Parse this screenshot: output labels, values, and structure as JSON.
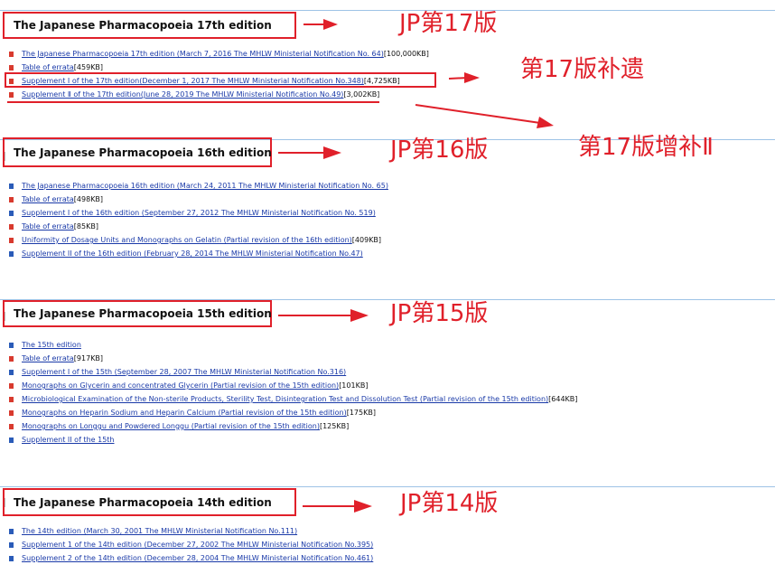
{
  "sections": [
    {
      "title": "The Japanese Pharmacopoeia 17th edition",
      "annotation": "JP第17版",
      "items": [
        {
          "text": "The Japanese Pharmacopoeia 17th edition (March 7, 2016 The MHLW Ministerial  Notification No. 64)",
          "size": "[100,000KB]",
          "type": "pdf"
        },
        {
          "text": "Table of errata",
          "size": "[459KB]",
          "type": "pdf"
        },
        {
          "text": "Supplement I of the 17th edition(December 1, 2017 The MHLW Ministerial Notification No.348)",
          "size": "[4,725KB]",
          "type": "pdf"
        },
        {
          "text": "Supplement  Ⅱ  of the 17th edition(June 28, 2019 The MHLW Ministerial Notification No.49)",
          "size": "[3,002KB]",
          "type": "pdf"
        }
      ]
    },
    {
      "title": "The Japanese Pharmacopoeia 16th edition",
      "annotation": "JP第16版",
      "items": [
        {
          "text": "The Japanese Pharmacopoeia 16th edition (March 24, 2011 The MHLW Ministerial  Notification No. 65)",
          "size": "",
          "type": "web"
        },
        {
          "text": "Table of errata",
          "size": "[498KB]",
          "type": "pdf"
        },
        {
          "text": "Supplement I of the 16th edition (September 27, 2012 The MHLW Ministerial Notification No. 519)",
          "size": "",
          "type": "web"
        },
        {
          "text": "Table of errata",
          "size": "[85KB]",
          "type": "pdf"
        },
        {
          "text": "Uniformity of Dosage Units and Monographs on Gelatin (Partial revision of the 16th edition)",
          "size": "[409KB]",
          "type": "pdf"
        },
        {
          "text": "Supplement II of the 16th edition (February 28, 2014 The MHLW Ministerial Notification No.47)",
          "size": "",
          "type": "web"
        }
      ]
    },
    {
      "title": "The Japanese Pharmacopoeia 15th edition",
      "annotation": "JP第15版",
      "items": [
        {
          "text": "The 15th edition",
          "size": "",
          "type": "web"
        },
        {
          "text": "Table of errata",
          "size": "[917KB]",
          "type": "pdf"
        },
        {
          "text": "Supplement I of the 15th (September 28, 2007 The MHLW Ministerial Notification No.316)",
          "size": "",
          "type": "web"
        },
        {
          "text": "Monographs on Glycerin and concentrated Glycerin (Partial revision of the 15th edition)",
          "size": "[101KB]",
          "type": "pdf"
        },
        {
          "text": "Microbiological Examination of the Non-sterile Products, Sterility Test, Disintegration Test and Dissolution Test (Partial revision of the 15th edition)",
          "size": "[644KB]",
          "type": "pdf"
        },
        {
          "text": "Monographs on Heparin Sodium and Heparin Calcium (Partial revision of the 15th edition)",
          "size": "[175KB]",
          "type": "pdf"
        },
        {
          "text": "Monographs on Longgu and Powdered Longgu (Partial revision of the 15th edition)",
          "size": "[125KB]",
          "type": "pdf"
        },
        {
          "text": "Supplement II of the 15th",
          "size": "",
          "type": "web"
        }
      ]
    },
    {
      "title": "The Japanese Pharmacopoeia 14th edition",
      "annotation": "JP第14版",
      "items": [
        {
          "text": "The 14th edition (March 30, 2001 The MHLW Ministerial Notification No.111)",
          "size": "",
          "type": "web"
        },
        {
          "text": "Supplement 1 of the 14th edition (December 27, 2002 The MHLW Ministerial Notification No.395)",
          "size": "",
          "type": "web"
        },
        {
          "text": "Supplement 2 of the 14th edition (December 28, 2004 The MHLW Ministerial Notification No.461)",
          "size": "",
          "type": "web"
        }
      ]
    }
  ],
  "callouts": {
    "supplement1": "第17版补遗",
    "supplement2": "第17版增补Ⅱ"
  },
  "colors": {
    "annotation_red": "#e0202a",
    "link_blue": "#1a3aa8",
    "divider_blue": "#9ec3e6",
    "pdf_icon": "#d83a2e",
    "web_icon": "#2a5bb8"
  }
}
